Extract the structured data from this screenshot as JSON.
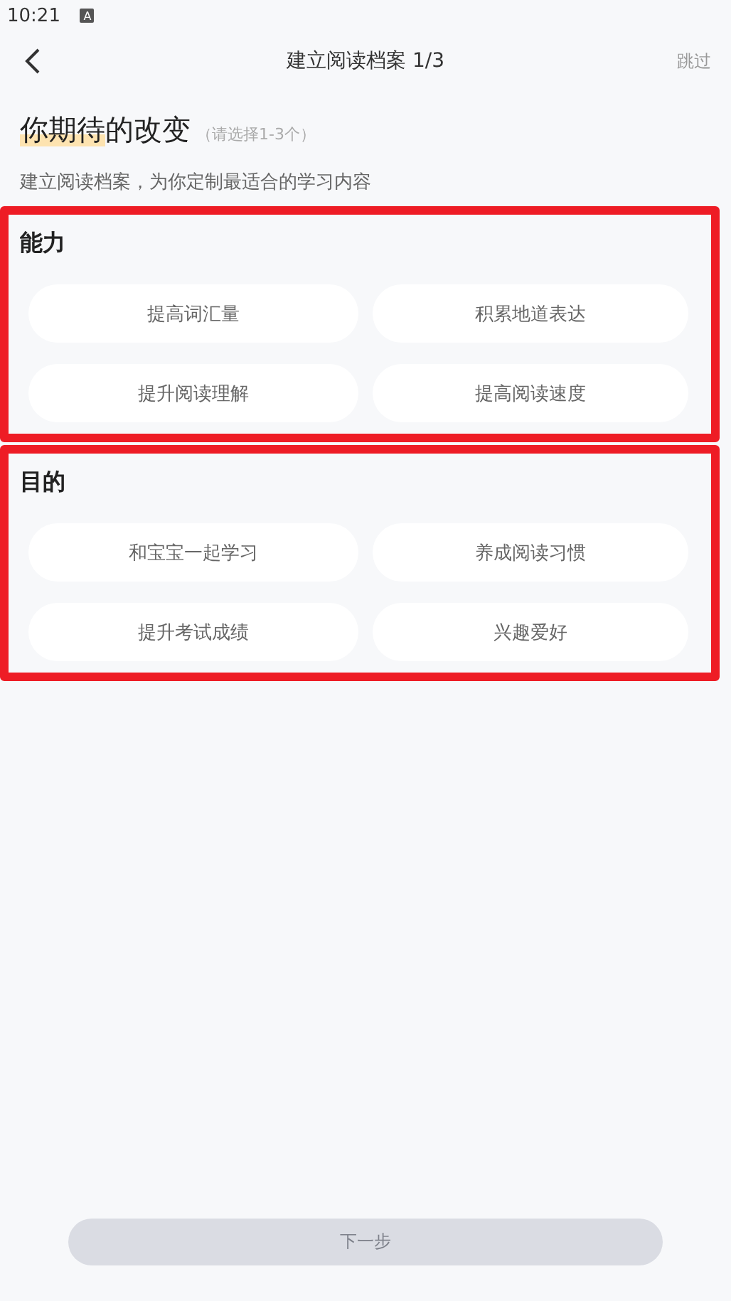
{
  "status_bar": {
    "time": "10:21",
    "badge": "A"
  },
  "nav": {
    "title": "建立阅读档案 1/3",
    "skip": "跳过"
  },
  "heading": {
    "title": "你期待的改变",
    "hint": "（请选择1-3个）"
  },
  "subtitle": "建立阅读档案，为你定制最适合的学习内容",
  "sections": [
    {
      "title": "能力",
      "highlighted": true,
      "options": [
        {
          "label": "提高词汇量",
          "selected": false
        },
        {
          "label": "积累地道表达",
          "selected": false
        },
        {
          "label": "提升阅读理解",
          "selected": false
        },
        {
          "label": "提高阅读速度",
          "selected": false
        }
      ]
    },
    {
      "title": "目的",
      "highlighted": true,
      "options": [
        {
          "label": "和宝宝一起学习",
          "selected": false
        },
        {
          "label": "养成阅读习惯",
          "selected": false
        },
        {
          "label": "提升考试成绩",
          "selected": false
        },
        {
          "label": "兴趣爱好",
          "selected": false
        }
      ]
    }
  ],
  "next_button": {
    "label": "下一步",
    "disabled": true
  }
}
